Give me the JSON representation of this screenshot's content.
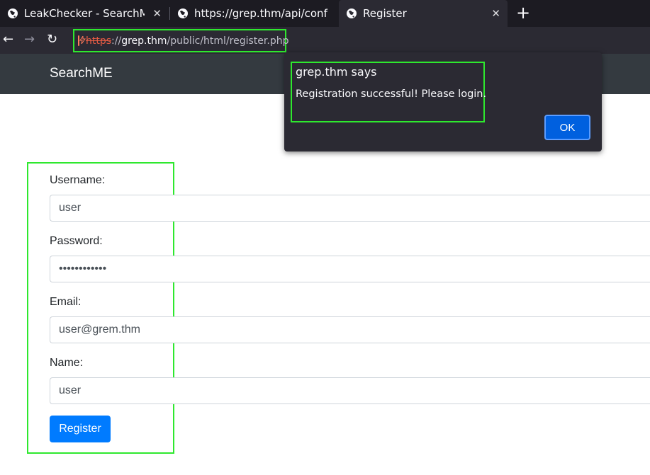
{
  "browser": {
    "tabs": [
      {
        "label": "LeakChecker - SearchME",
        "icon": "globe-icon",
        "active": false
      },
      {
        "label": "https://grep.thm/api/conf",
        "icon": "globe-icon",
        "active": false
      },
      {
        "label": "Register",
        "icon": "globe-icon",
        "active": true
      }
    ],
    "close_glyph": "✕",
    "new_tab_glyph": "+",
    "nav": {
      "back": "←",
      "forward": "→",
      "reload": "↻"
    },
    "url": {
      "scheme": "https",
      "separator": "://",
      "host": "grep.thm",
      "path": "/public/html/register.php"
    }
  },
  "site": {
    "brand": "SearchME"
  },
  "dialog": {
    "title": "grep.thm says",
    "message": "Registration successful! Please login.",
    "ok_label": "OK"
  },
  "form": {
    "username_label": "Username:",
    "username_value": "user",
    "password_label": "Password:",
    "password_value": "••••••••••••",
    "email_label": "Email:",
    "email_value": "user@grem.thm",
    "name_label": "Name:",
    "name_value": "user",
    "submit_label": "Register"
  },
  "colors": {
    "highlight": "#2ee82e",
    "primary_button": "#007bff",
    "header_bg": "#343a40"
  }
}
